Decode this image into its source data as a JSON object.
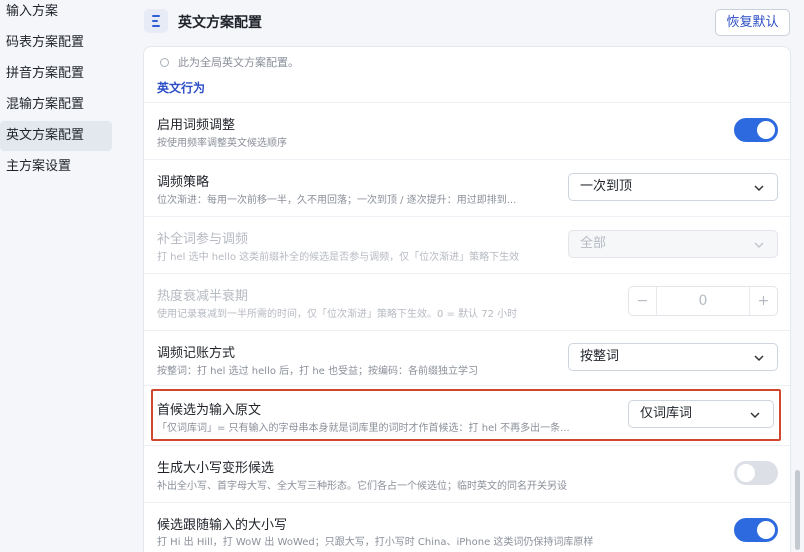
{
  "sidebar": {
    "items": [
      {
        "label": "输入方案",
        "active": false
      },
      {
        "label": "码表方案配置",
        "active": false
      },
      {
        "label": "拼音方案配置",
        "active": false
      },
      {
        "label": "混输方案配置",
        "active": false
      },
      {
        "label": "英文方案配置",
        "active": true
      },
      {
        "label": "主方案设置",
        "active": false
      }
    ]
  },
  "header": {
    "icon": "list-icon",
    "title": "英文方案配置",
    "reset_label": "恢复默认"
  },
  "note": "此为全局英文方案配置。",
  "section": {
    "title": "英文行为"
  },
  "rows": {
    "freq_adjust": {
      "title": "启用词频调整",
      "desc": "按使用频率调整英文候选顺序",
      "enabled": true
    },
    "freq_strategy": {
      "title": "调频策略",
      "desc": "位次渐进：每用一次前移一半，久不用回落；一次到顶 / 逐次提升：用过即排到...",
      "value": "一次到顶"
    },
    "completion_adjust": {
      "title": "补全词参与调频",
      "desc": "打 hel 选中 hello 这类前缀补全的候选是否参与调频，仅「位次渐进」策略下生效",
      "value": "全部",
      "disabled": true
    },
    "decay": {
      "title": "热度衰减半衰期",
      "desc": "使用记录衰减到一半所需的时间，仅「位次渐进」策略下生效。0 = 默认 72 小时",
      "value": "0",
      "minus": "−",
      "plus": "+",
      "disabled": true
    },
    "accounting": {
      "title": "调频记账方式",
      "desc": "按整词：打 hel 选过 hello 后，打 he 也受益；按编码：各前缀独立学习",
      "value": "按整词"
    },
    "first_raw": {
      "title": "首候选为输入原文",
      "desc": "「仅词库词」= 只有输入的字母串本身就是词库里的词时才作首候选：打 hel 不再多出一条...",
      "value": "仅词库词"
    },
    "case_variants": {
      "title": "生成大小写变形候选",
      "desc": "补出全小写、首字母大写、全大写三种形态。它们各占一个候选位；临时英文的同名开关另设",
      "enabled": false
    },
    "follow_case": {
      "title": "候选跟随输入的大小写",
      "desc": "打 Hi 出 Hill，打 WoW 出 WoWed；只跟大写，打小写时 China、iPhone 这类词仍保持词库原样",
      "enabled": true
    }
  },
  "colors": {
    "accent": "#2d6ae0",
    "section_title": "#2b4cc5",
    "highlight_border": "#d0462f"
  }
}
